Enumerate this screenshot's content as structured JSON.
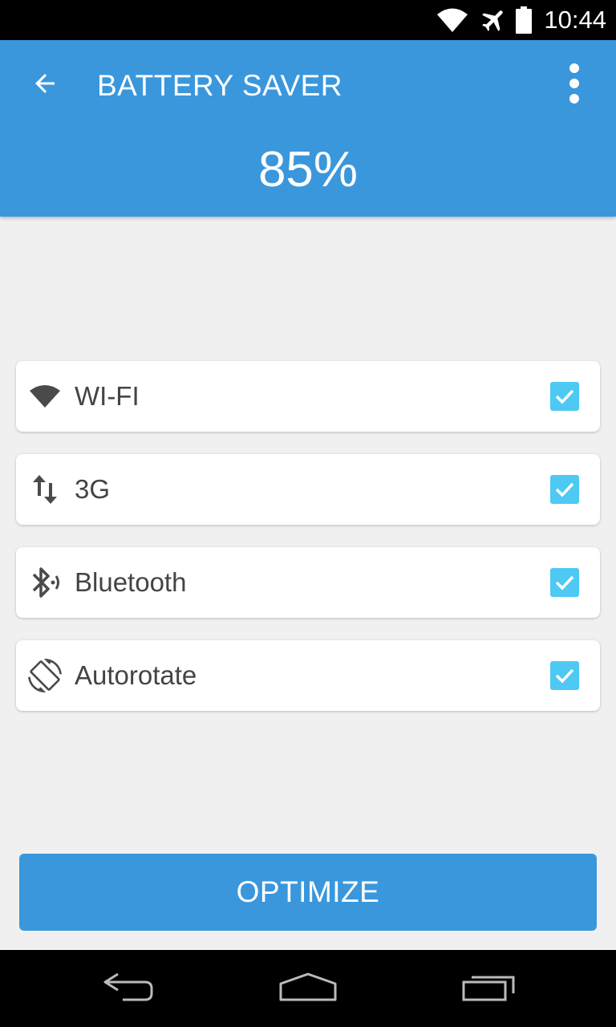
{
  "status_bar": {
    "time": "10:44",
    "icons": [
      "wifi-icon",
      "airplane-mode-icon",
      "battery-icon"
    ]
  },
  "app_bar": {
    "title": "BATTERY SAVER",
    "battery_percent": "85%",
    "back_icon": "arrow-back-icon",
    "menu_icon": "more-vert-icon",
    "color": "#3a97dc"
  },
  "options": [
    {
      "label": "WI-FI",
      "icon": "wifi-icon",
      "checked": true
    },
    {
      "label": "3G",
      "icon": "mobile-data-icon",
      "checked": true
    },
    {
      "label": "Bluetooth",
      "icon": "bluetooth-icon",
      "checked": true
    },
    {
      "label": "Autorotate",
      "icon": "screen-rotation-icon",
      "checked": true
    }
  ],
  "checkbox_color": "#4dc9f3",
  "actions": {
    "optimize_label": "OPTIMIZE"
  },
  "nav_bar": {
    "icons": [
      "back-icon",
      "home-icon",
      "recents-icon"
    ]
  }
}
